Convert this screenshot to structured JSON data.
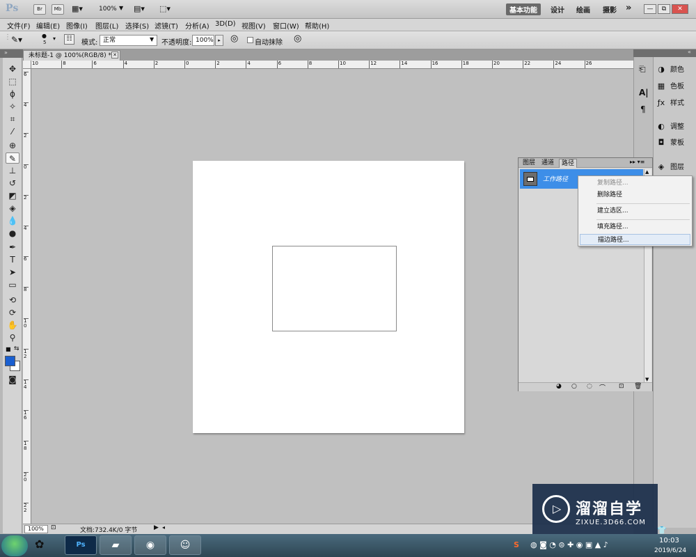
{
  "appbar": {
    "logo": "Ps",
    "bridge": "Br",
    "minibridge": "Mb",
    "zoom": "100%",
    "workspaces": [
      "基本功能",
      "设计",
      "绘画",
      "摄影"
    ],
    "more": "»",
    "window_controls": [
      "—",
      "⧉",
      "✕"
    ]
  },
  "menu": [
    "文件(F)",
    "编辑(E)",
    "图像(I)",
    "图层(L)",
    "选择(S)",
    "滤镜(T)",
    "分析(A)",
    "3D(D)",
    "视图(V)",
    "窗口(W)",
    "帮助(H)"
  ],
  "options": {
    "brush_size": "5",
    "mode_label": "模式:",
    "mode_value": "正常",
    "opacity_label": "不透明度:",
    "opacity_value": "100%",
    "autoerase_label": "自动抹除"
  },
  "document": {
    "tab_title": "未标题-1 @ 100%(RGB/8) *",
    "tab_close": "✕",
    "zoom": "100%",
    "doc_info": "文档:732.4K/0 字节"
  },
  "rulers": {
    "h_ticks": [
      "10",
      "8",
      "6",
      "4",
      "2",
      "0",
      "2",
      "4",
      "6",
      "8",
      "10",
      "12",
      "14",
      "16",
      "18",
      "20",
      "22",
      "24",
      "26"
    ],
    "v_ticks": [
      "6",
      "4",
      "2",
      "0",
      "2",
      "4",
      "6",
      "8",
      "1 0",
      "1 2",
      "1 4",
      "1 6",
      "1 8",
      "2 0",
      "2 2"
    ]
  },
  "dock": {
    "items": [
      {
        "icon": "color-icon",
        "label": "颜色"
      },
      {
        "icon": "swatches-icon",
        "label": "色板"
      },
      {
        "icon": "styles-icon",
        "label": "样式"
      },
      {
        "icon": "adjustments-icon",
        "label": "调整"
      },
      {
        "icon": "masks-icon",
        "label": "蒙板"
      },
      {
        "icon": "layers-icon",
        "label": "图层"
      }
    ]
  },
  "paths_panel": {
    "tabs": [
      "图层",
      "通道",
      "路径"
    ],
    "active_tab": "路径",
    "path_name": "工作路径",
    "menu_glyph": "▸▸ ▾≡"
  },
  "context_menu": {
    "items": [
      {
        "label": "复制路径...",
        "disabled": true
      },
      {
        "label": "删除路径",
        "disabled": false
      },
      {
        "label": "建立选区...",
        "disabled": false
      },
      {
        "label": "填充路径...",
        "disabled": false
      },
      {
        "label": "描边路径...",
        "disabled": false,
        "highlighted": true
      }
    ]
  },
  "taskbar": {
    "apps": [
      "Ps"
    ],
    "time": "10:03",
    "date": "2019/6/24"
  },
  "watermark": {
    "title": "溜溜自学",
    "subtitle": "ZIXUE.3D66.COM"
  },
  "colors": {
    "foreground": "#1a5fd0",
    "background": "#ffffff",
    "selection": "#3d8ee8"
  }
}
